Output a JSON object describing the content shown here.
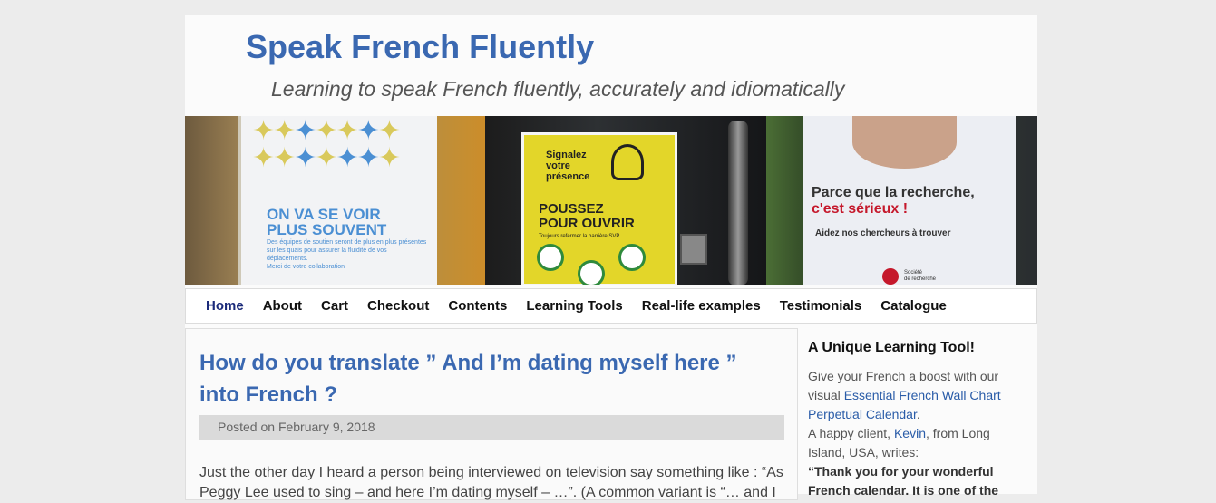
{
  "site": {
    "title": "Speak French Fluently",
    "description": "Learning to speak French fluently, accurately and idiomatically"
  },
  "banner": {
    "poster1_heading_line1": "ON VA SE VOIR",
    "poster1_heading_line2": "PLUS SOUVENT",
    "poster1_small": "Des équipes de soutien seront de plus en plus présentes sur les quais pour assurer la fluidité de vos déplacements.",
    "poster1_thanks": "Merci de votre collaboration",
    "poster2_top_line1": "Signalez",
    "poster2_top_line2": "votre",
    "poster2_top_line3": "présence",
    "poster2_main_line1": "POUSSEZ",
    "poster2_main_line2": "POUR OUVRIR",
    "poster2_small": "Toujours refermer la barrière SVP",
    "poster3_line1": "Parce que la recherche,",
    "poster3_line2": "c'est sérieux !",
    "poster3_sub": "Aidez nos chercheurs à trouver",
    "poster3_logo_line1": "Société",
    "poster3_logo_line2": "de recherche",
    "colors": {
      "poster_blue": "#4b8fd3",
      "poster_yellow": "#e3d629",
      "poster_red": "#c5182b"
    }
  },
  "nav": {
    "items": [
      {
        "label": "Home",
        "active": true
      },
      {
        "label": "About",
        "active": false
      },
      {
        "label": "Cart",
        "active": false
      },
      {
        "label": "Checkout",
        "active": false
      },
      {
        "label": "Contents",
        "active": false
      },
      {
        "label": "Learning Tools",
        "active": false
      },
      {
        "label": "Real-life examples",
        "active": false
      },
      {
        "label": "Testimonials",
        "active": false
      },
      {
        "label": "Catalogue",
        "active": false
      }
    ]
  },
  "post": {
    "title": "How do you translate ” And I’m dating myself here ” into French ?",
    "meta": "Posted on February 9, 2018",
    "body": "Just the other day I heard a person being interviewed on television say something like : “As Peggy Lee used to sing – and here I’m dating myself – …”. (A common variant is “… and I"
  },
  "sidebar": {
    "title": "A Unique Learning Tool!",
    "text1": "Give your French a boost with our visual ",
    "link1": "Essential French Wall Chart Perpetual Calendar",
    "text2": ".",
    "text3": "A happy client, ",
    "link2": "Kevin",
    "text4": ", from Long Island, USA, writes:",
    "quote": "“Thank you for your wonderful French calendar. It is one of the"
  },
  "colors": {
    "page_bg": "#ececec",
    "accent_blue": "#3a68b1",
    "link_blue": "#2a5ca8",
    "active_nav": "#1b2a7a"
  }
}
